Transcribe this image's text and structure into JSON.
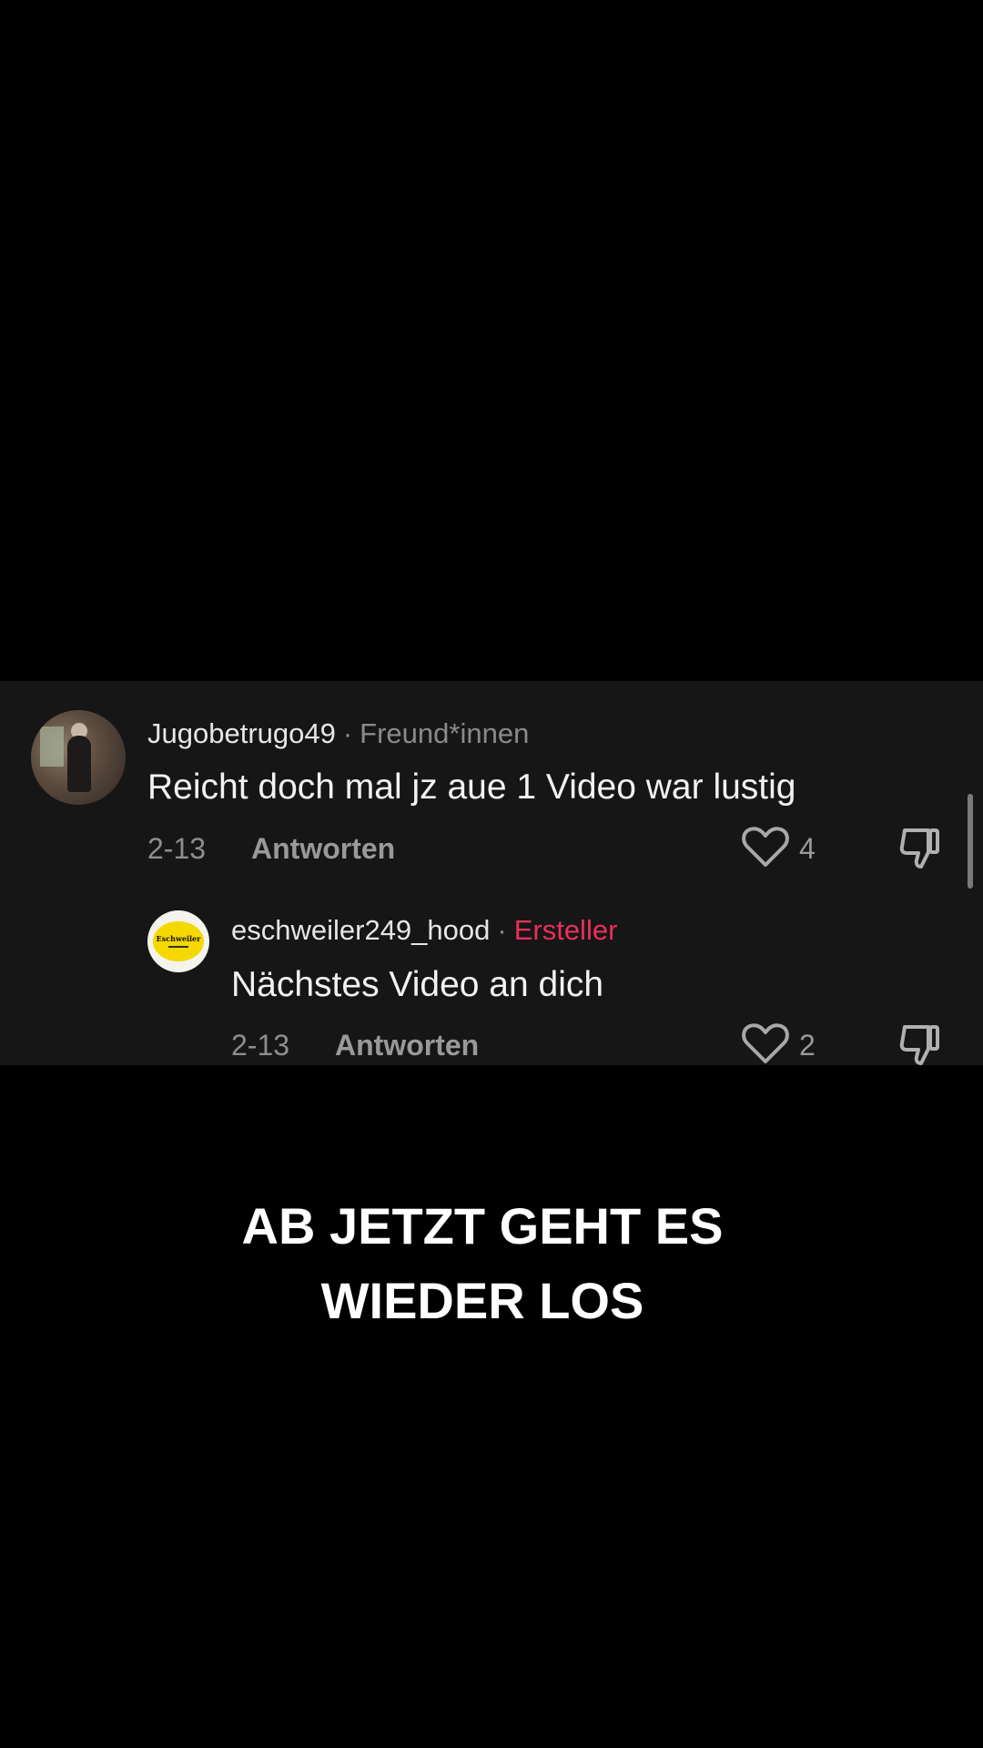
{
  "comments": [
    {
      "username": "Jugobetrugo49",
      "tag": "Freund*innen",
      "text": "Reicht doch mal jz aue 1 Video war lustig",
      "date": "2-13",
      "reply_label": "Antworten",
      "likes": "4"
    },
    {
      "username": "eschweiler249_hood",
      "tag": "Ersteller",
      "text": "Nächstes Video an dich",
      "date": "2-13",
      "reply_label": "Antworten",
      "likes": "2",
      "avatar_logo_text": "Eschweiler"
    }
  ],
  "separator": "·",
  "caption": {
    "line1": "AB JETZT GEHT ES",
    "line2": "WIEDER LOS"
  },
  "colors": {
    "background": "#000000",
    "panel": "#161616",
    "creator_tag": "#e8305a",
    "muted_text": "#8e8e8e"
  },
  "icons": {
    "like": "heart-outline-icon",
    "dislike": "thumbs-down-outline-icon"
  }
}
